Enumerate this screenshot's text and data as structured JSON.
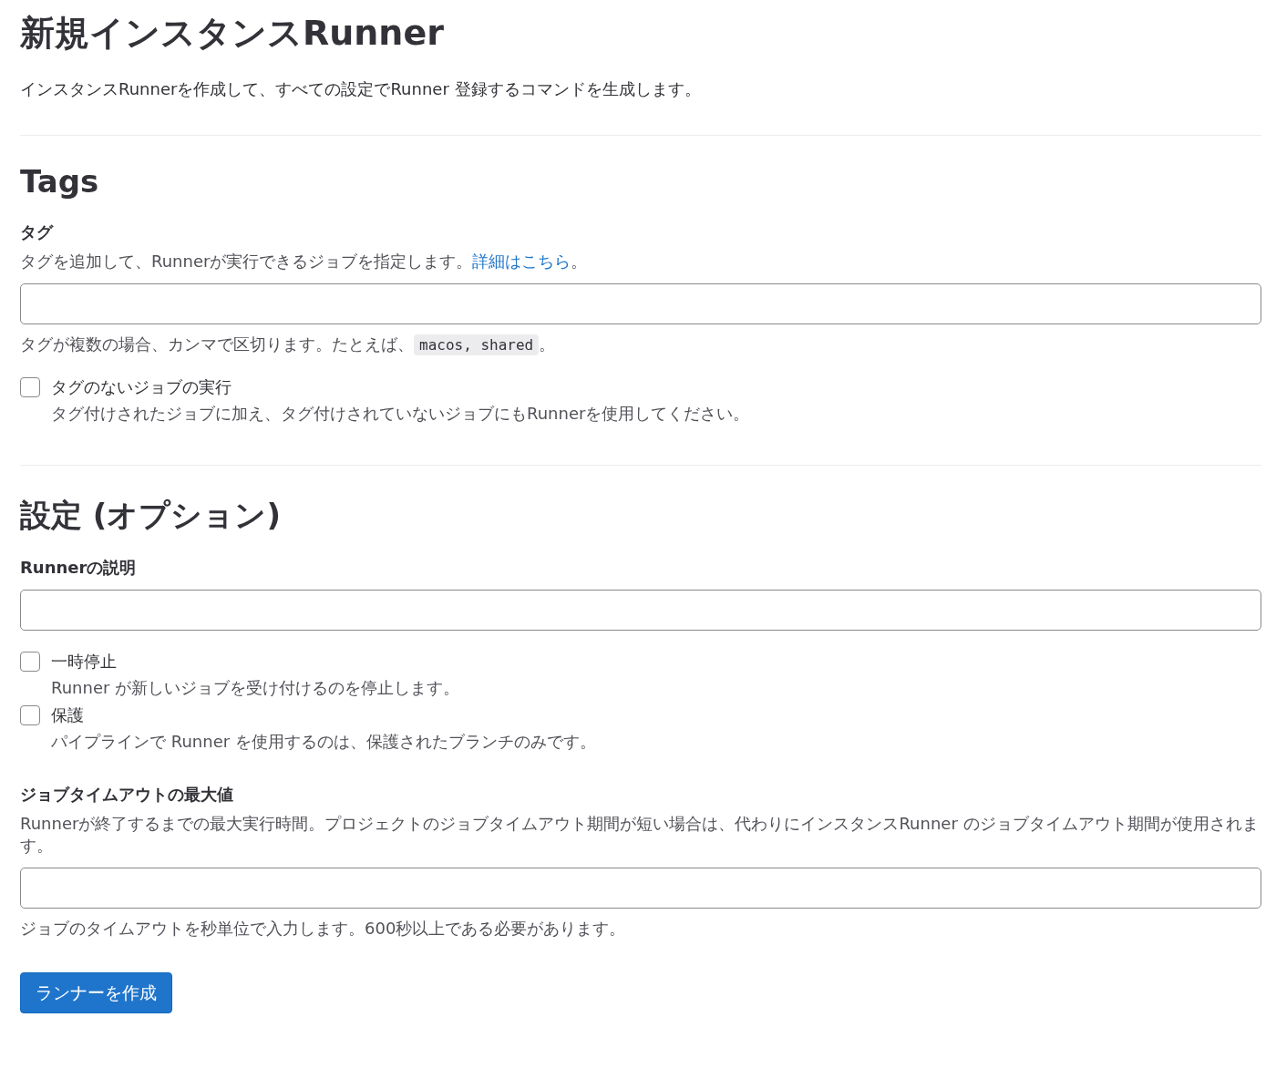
{
  "title": "新規インスタンスRunner",
  "description": "インスタンスRunnerを作成して、すべての設定でRunner 登録するコマンドを生成します。",
  "tags_section": {
    "heading": "Tags",
    "label": "タグ",
    "help": "タグを追加して、Runnerが実行できるジョブを指定します。",
    "help_link": "詳細はこちら",
    "help_end": "。",
    "hint_before": "タグが複数の場合、カンマで区切ります。たとえば、",
    "hint_code": "macos, shared",
    "hint_after": "。",
    "checkboxes": [
      {
        "label": "タグのないジョブの実行",
        "description": "タグ付けされたジョブに加え、タグ付けされていないジョブにもRunnerを使用してください。",
        "checked": false
      }
    ]
  },
  "settings_section": {
    "heading": "設定 (オプション)",
    "description_label": "Runnerの説明",
    "checkboxes": [
      {
        "label": "一時停止",
        "description": "Runner が新しいジョブを受け付けるのを停止します。",
        "checked": false
      },
      {
        "label": "保護",
        "description": "パイプラインで Runner を使用するのは、保護されたブランチのみです。",
        "checked": false
      }
    ],
    "timeout_label": "ジョブタイムアウトの最大値",
    "timeout_help": "Runnerが終了するまでの最大実行時間。プロジェクトのジョブタイムアウト期間が短い場合は、代わりにインスタンスRunner のジョブタイムアウト期間が使用されます。",
    "timeout_hint": "ジョブのタイムアウトを秒単位で入力します。600秒以上である必要があります。"
  },
  "submit_button": "ランナーを作成"
}
